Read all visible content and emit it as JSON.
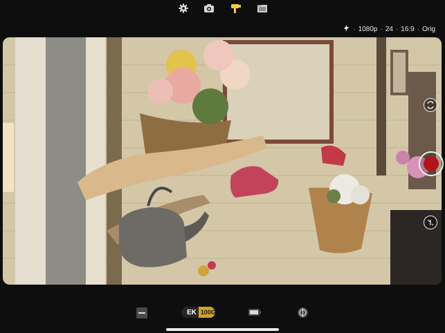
{
  "top_toolbar": {
    "items": [
      {
        "name": "settings",
        "icon": "gear-icon"
      },
      {
        "name": "photo",
        "icon": "camera-icon"
      },
      {
        "name": "video",
        "icon": "video-camera-icon",
        "active": true
      },
      {
        "name": "library",
        "icon": "folder-icon"
      }
    ],
    "active_color": "#f2c94c"
  },
  "status": {
    "resolution": "1080p",
    "fps": "24",
    "aspect": "16:9",
    "crop": "Orig",
    "separator": "·"
  },
  "bottom_toolbar": {
    "film_brand": "EK",
    "film_stock": "100G",
    "film_accent": "#d4a02b"
  },
  "record_color": "#b0151b"
}
